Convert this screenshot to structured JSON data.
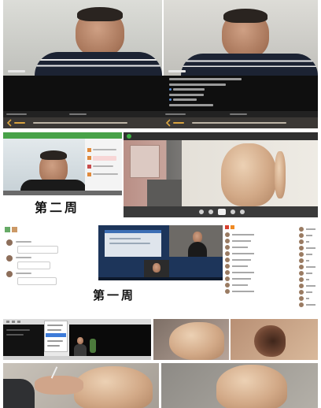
{
  "labels": {
    "week_two": "第二周",
    "week_one": "第一周"
  },
  "colors": {
    "page_background": "#ffffff",
    "call_info_background": "#0f0f0f",
    "app_top_bar_green": "#48a248",
    "nav_back_accent": "#d9a441",
    "desktop_wallpaper_blue": "#1d355a"
  },
  "icons": {
    "back": "chevron-left-icon",
    "chat_app_logo": "chat-app-logo-icon",
    "call_control": "call-control-icon",
    "avatar": "avatar-icon"
  }
}
